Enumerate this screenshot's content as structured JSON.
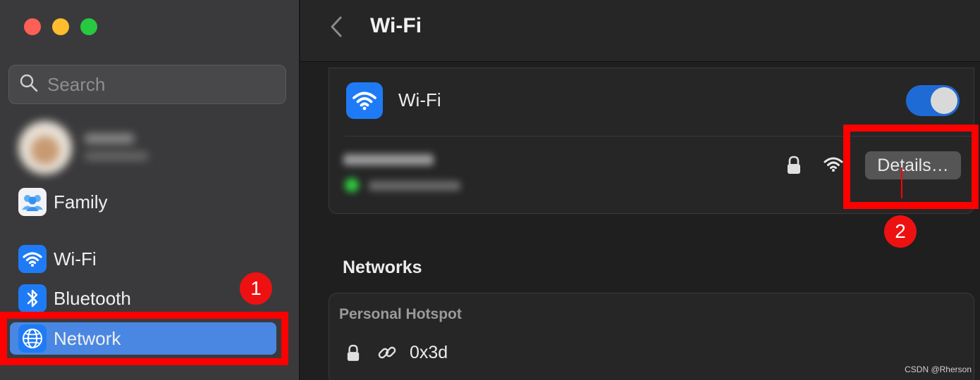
{
  "window": {
    "controls": [
      "close",
      "minimize",
      "zoom"
    ]
  },
  "sidebar": {
    "search": {
      "placeholder": "Search",
      "value": ""
    },
    "items": [
      {
        "label": "Family",
        "icon": "family-icon"
      },
      {
        "label": "Wi-Fi",
        "icon": "wifi-icon"
      },
      {
        "label": "Bluetooth",
        "icon": "bluetooth-icon"
      },
      {
        "label": "Network",
        "icon": "globe-icon",
        "selected": true
      }
    ]
  },
  "header": {
    "title": "Wi-Fi"
  },
  "wifi_card": {
    "label": "Wi-Fi",
    "toggle_on": true,
    "details_label": "Details…"
  },
  "networks": {
    "section_title": "Networks",
    "hotspot_label": "Personal Hotspot",
    "hotspot_name": "0x3d"
  },
  "annotations": {
    "badge_1": "1",
    "badge_2": "2",
    "color": "#ff0000"
  },
  "watermark": "CSDN @Rherson",
  "colors": {
    "accent": "#1f7bf5",
    "selection": "#4a87e3",
    "toggle_on": "#1f6bd6"
  }
}
